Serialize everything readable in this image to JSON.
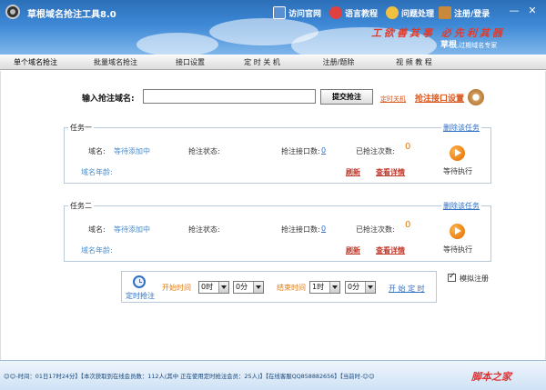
{
  "window": {
    "title": "草根域名抢注工具8.0",
    "minimize": "—",
    "close": "✕"
  },
  "header_links": [
    {
      "label": "访问官网"
    },
    {
      "label": "语言教程"
    },
    {
      "label": "问题处理"
    },
    {
      "label": "注册/登录"
    }
  ],
  "slogan": "工欲善其事 必先利其器",
  "brand": {
    "name": "草根",
    "tagline": ",过期域名专家"
  },
  "nav": [
    "单个域名抢注",
    "批量域名抢注",
    "接口设置",
    "定 时 关 机",
    "注册/题除",
    "视 频 教 程"
  ],
  "form": {
    "label": "输入抢注域名:",
    "value": "",
    "submit": "提交抢注",
    "timed_shutdown": "定时关机",
    "api_settings": "抢注接口设置"
  },
  "tasks": [
    {
      "title": "任务一",
      "delete": "删除该任务",
      "domain_label": "域名:",
      "domain_value": "等待添加中",
      "status_label": "抢注状态:",
      "status_value": "",
      "api_count_label": "抢注接口数:",
      "api_count": "0",
      "attempts_label": "已抢注次数:",
      "attempts": "0",
      "age_label": "域名年龄:",
      "refresh": "刷新",
      "details": "查看详情",
      "state": "等待执行"
    },
    {
      "title": "任务二",
      "delete": "删除该任务",
      "domain_label": "域名:",
      "domain_value": "等待添加中",
      "status_label": "抢注状态:",
      "status_value": "",
      "api_count_label": "抢注接口数:",
      "api_count": "0",
      "attempts_label": "已抢注次数:",
      "attempts": "0",
      "age_label": "域名年龄:",
      "refresh": "刷新",
      "details": "查看详情",
      "state": "等待执行"
    }
  ],
  "timer": {
    "label": "定时抢注",
    "start_label": "开始时间",
    "start_hour": "0时",
    "start_min": "0分",
    "end_label": "结束时间",
    "end_hour": "1时",
    "end_min": "0分",
    "set_button": "开 始 定 时"
  },
  "simulate": {
    "label": "模拟注册",
    "checked": true
  },
  "status_bar": "☺☺-时间：01日17时24分】【本次获取到在线会员数：112人(其中 正在使用定时抢注会员：25人)】【在线客服QQ858882656】【当前时-☺☺",
  "watermark": "脚本之家",
  "colors": {
    "header": "#3d88d6",
    "accent_orange": "#e07a10",
    "link_blue": "#2f6fc5",
    "link_red": "#d9561c"
  }
}
